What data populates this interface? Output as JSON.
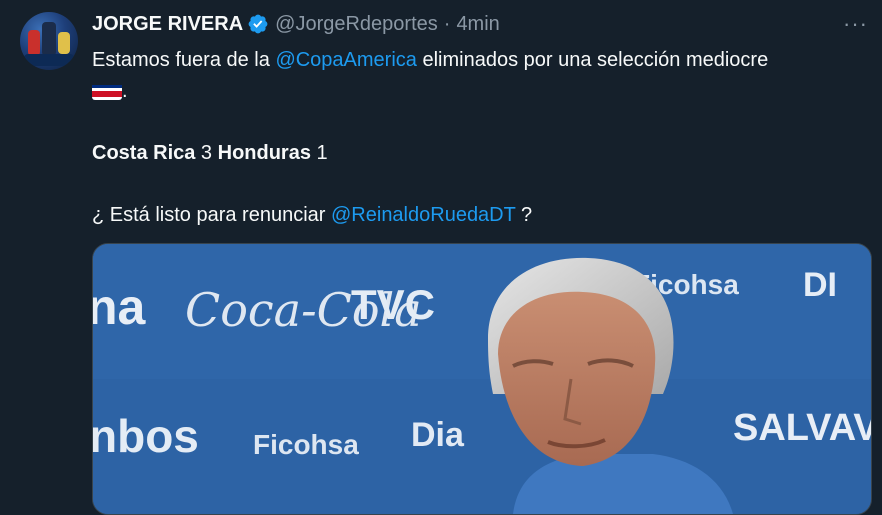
{
  "tweet": {
    "author_name": "JORGE RIVERA",
    "handle": "@JorgeRdeportes",
    "separator": "·",
    "time": "4min",
    "more": "···",
    "line1_before": "Estamos fuera de la ",
    "mention1": "@CopaAmerica",
    "line1_after": " eliminados por una selección mediocre",
    "line2_after": ".",
    "score_team1": "Costa Rica",
    "score_value1": " 3 ",
    "score_team2": "Honduras",
    "score_value2": " 1",
    "question_before": "¿ Está listo para renunciar ",
    "mention2": "@ReinaldoRuedaDT",
    "question_after": " ?"
  },
  "media": {
    "sponsor_texts": [
      "na",
      "Coca-Cola",
      "TVC",
      "Ficohsa",
      "DI",
      "nbos",
      "Ficohsa",
      "Dia",
      "SALVAVI"
    ]
  },
  "colors": {
    "background": "#15202b",
    "text": "#f7f9f9",
    "secondary": "#8b98a5",
    "link": "#1d9bf0",
    "verified": "#1d9bf0"
  },
  "icons": [
    "verified-badge-icon",
    "more-icon",
    "costa-rica-flag-icon"
  ]
}
